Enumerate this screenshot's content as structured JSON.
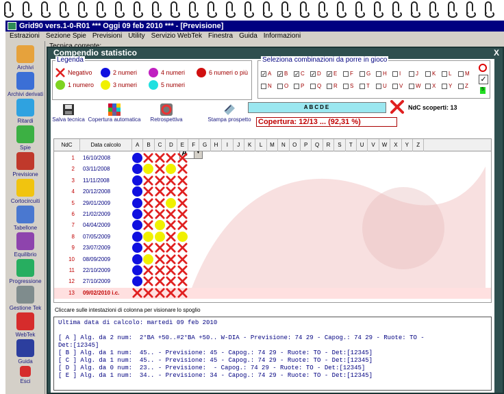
{
  "window": {
    "title": "Grid90 vers.1-0-R01   ***   Oggi 09 feb 2010   ***   - [Previsione]"
  },
  "menu": [
    "Estrazioni",
    "Sezione Spie",
    "Previsioni",
    "Utility",
    "Servizio WebTek",
    "Finestra",
    "Guida",
    "Informazioni"
  ],
  "sidebar": [
    {
      "label": "Archivi",
      "icon": "pencil-icon",
      "color": "#e6a23c"
    },
    {
      "label": "Archivi derivati",
      "icon": "book-icon",
      "color": "#3b6fd6"
    },
    {
      "label": "Ritardi",
      "icon": "clock-icon",
      "color": "#2fa2e0"
    },
    {
      "label": "Spie",
      "icon": "lamp-icon",
      "color": "#3cb043"
    },
    {
      "label": "Previsione",
      "icon": "clipboard-icon",
      "color": "#c0392b"
    },
    {
      "label": "Cortocircuiti",
      "icon": "bulb-icon",
      "color": "#f1c40f"
    },
    {
      "label": "Tabellone",
      "icon": "table-icon",
      "color": "#4a78d0"
    },
    {
      "label": "Equilibrio",
      "icon": "scales-icon",
      "color": "#8e44ad"
    },
    {
      "label": "Progressione",
      "icon": "dollar-icon",
      "color": "#27ae60"
    },
    {
      "label": "Gestione Tek",
      "icon": "tools-icon",
      "color": "#7f8c8d"
    },
    {
      "label": "WebTek",
      "icon": "webtek-icon",
      "color": "#d62c2c"
    },
    {
      "label": "Guida",
      "icon": "book-pen-icon",
      "color": "#2c3e9e"
    },
    {
      "label": "Esci",
      "icon": "power-icon",
      "color": "#d62c2c"
    }
  ],
  "workspace": {
    "tecnica_label": "Tecnica corrente:"
  },
  "panel_title": "Compendio statistico",
  "legend": {
    "title": "Legenda",
    "items": [
      {
        "label": "Negativo",
        "kind": "x"
      },
      {
        "label": "1 numero",
        "color": "#7ed321"
      },
      {
        "label": "2 numeri",
        "color": "#1010e0"
      },
      {
        "label": "3 numeri",
        "color": "#f0f000"
      },
      {
        "label": "4 numeri",
        "color": "#c020c0"
      },
      {
        "label": "5 numeri",
        "color": "#20e0e0"
      },
      {
        "label": "6 numeri o più",
        "color": "#d01010"
      }
    ]
  },
  "combinations": {
    "title": "Seleziona combinazioni da porre in gioco",
    "letters": [
      {
        "l": "A",
        "on": true
      },
      {
        "l": "B",
        "on": true
      },
      {
        "l": "C",
        "on": true
      },
      {
        "l": "D",
        "on": true
      },
      {
        "l": "E",
        "on": true
      },
      {
        "l": "F",
        "on": false
      },
      {
        "l": "G",
        "on": false
      },
      {
        "l": "H",
        "on": false
      },
      {
        "l": "I",
        "on": false
      },
      {
        "l": "J",
        "on": false
      },
      {
        "l": "K",
        "on": false
      },
      {
        "l": "L",
        "on": false
      },
      {
        "l": "M",
        "on": false
      },
      {
        "l": "N",
        "on": false
      },
      {
        "l": "O",
        "on": false
      },
      {
        "l": "P",
        "on": false
      },
      {
        "l": "Q",
        "on": false
      },
      {
        "l": "R",
        "on": false
      },
      {
        "l": "S",
        "on": false
      },
      {
        "l": "T",
        "on": false
      },
      {
        "l": "U",
        "on": false
      },
      {
        "l": "V",
        "on": false
      },
      {
        "l": "W",
        "on": false
      },
      {
        "l": "X",
        "on": false
      },
      {
        "l": "Y",
        "on": false
      },
      {
        "l": "Z",
        "on": false
      }
    ],
    "count_badge": "5"
  },
  "toolbar": {
    "salva": "Salva tecnica",
    "copertura": "Copertura automatica",
    "retro": "Retrospettiva",
    "letter": "A",
    "stampa": "Stampa prospetto"
  },
  "abcde": "ABCDE",
  "copertura_text": "Copertura: 12/13 ... (92,31 %)",
  "ndc_scoperti": "NdC scoperti: 13",
  "grid": {
    "headers": {
      "ndc": "NdC",
      "data": "Data calcolo"
    },
    "columns": [
      "A",
      "B",
      "C",
      "D",
      "E",
      "F",
      "G",
      "H",
      "I",
      "J",
      "K",
      "L",
      "M",
      "N",
      "O",
      "P",
      "Q",
      "R",
      "S",
      "T",
      "U",
      "V",
      "W",
      "X",
      "Y",
      "Z"
    ],
    "rows": [
      {
        "n": "1",
        "d": "16/10/2008",
        "m": [
          "b",
          "x",
          "x",
          "x",
          "x"
        ]
      },
      {
        "n": "2",
        "d": "03/11/2008",
        "m": [
          "b",
          "y",
          "x",
          "y",
          "x"
        ]
      },
      {
        "n": "3",
        "d": "11/11/2008",
        "m": [
          "b",
          "x",
          "x",
          "x",
          "x"
        ]
      },
      {
        "n": "4",
        "d": "20/12/2008",
        "m": [
          "b",
          "x",
          "x",
          "x",
          "x"
        ]
      },
      {
        "n": "5",
        "d": "29/01/2009",
        "m": [
          "b",
          "x",
          "x",
          "y",
          "x"
        ]
      },
      {
        "n": "6",
        "d": "21/02/2009",
        "m": [
          "b",
          "x",
          "x",
          "x",
          "x"
        ]
      },
      {
        "n": "7",
        "d": "04/04/2009",
        "m": [
          "b",
          "x",
          "y",
          "x",
          "x"
        ]
      },
      {
        "n": "8",
        "d": "07/05/2009",
        "m": [
          "b",
          "y",
          "y",
          "x",
          "y"
        ]
      },
      {
        "n": "9",
        "d": "23/07/2009",
        "m": [
          "b",
          "x",
          "x",
          "x",
          "x"
        ]
      },
      {
        "n": "10",
        "d": "08/09/2009",
        "m": [
          "b",
          "y",
          "x",
          "x",
          "x"
        ]
      },
      {
        "n": "11",
        "d": "22/10/2009",
        "m": [
          "b",
          "x",
          "x",
          "x",
          "x"
        ]
      },
      {
        "n": "12",
        "d": "27/10/2009",
        "m": [
          "b",
          "x",
          "x",
          "x",
          "x"
        ]
      },
      {
        "n": "13",
        "d": "09/02/2010 i.c.",
        "m": [
          "x",
          "x",
          "x",
          "x",
          "x"
        ]
      }
    ]
  },
  "hint": "Cliccare sulle intestazioni di colonna per visionare lo spoglio",
  "log_lines": [
    "Ultima data di calcolo: martedì 09 feb 2010",
    "",
    "[ A ] Alg. da 2 num:  2°BA +50..#2°BA +50.. W-DIA - Previsione: 74 29 - Capog.: 74 29 - Ruote: TO -",
    "Det:[12345]",
    "[ B ] Alg. da 1 num:  45.. - Previsione: 45 - Capog.: 74 29 - Ruote: TO - Det:[12345]",
    "[ C ] Alg. da 1 num:  45.. - Previsione: 45 - Capog.: 74 29 - Ruote: TO - Det:[12345]",
    "[ D ] Alg. da 0 num:  23.. - Previsione:  - Capog.: 74 29 - Ruote: TO - Det:[12345]",
    "[ E ] Alg. da 1 num:  34.. - Previsione: 34 - Capog.: 74 29 - Ruote: TO - Det:[12345]"
  ]
}
